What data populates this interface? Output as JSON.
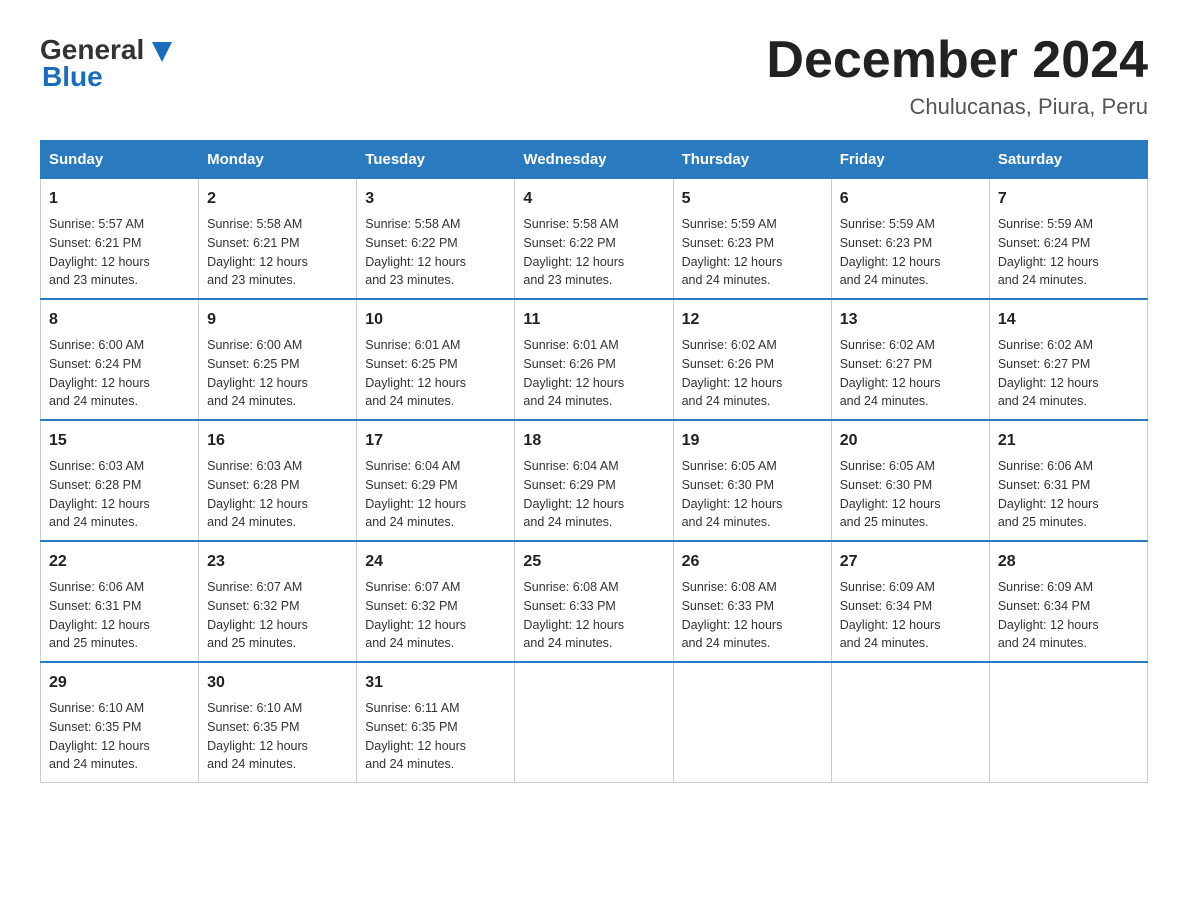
{
  "header": {
    "logo_general": "General",
    "logo_blue": "Blue",
    "month_title": "December 2024",
    "location": "Chulucanas, Piura, Peru"
  },
  "days_of_week": [
    "Sunday",
    "Monday",
    "Tuesday",
    "Wednesday",
    "Thursday",
    "Friday",
    "Saturday"
  ],
  "weeks": [
    [
      {
        "day": "1",
        "sunrise": "5:57 AM",
        "sunset": "6:21 PM",
        "daylight": "12 hours and 23 minutes."
      },
      {
        "day": "2",
        "sunrise": "5:58 AM",
        "sunset": "6:21 PM",
        "daylight": "12 hours and 23 minutes."
      },
      {
        "day": "3",
        "sunrise": "5:58 AM",
        "sunset": "6:22 PM",
        "daylight": "12 hours and 23 minutes."
      },
      {
        "day": "4",
        "sunrise": "5:58 AM",
        "sunset": "6:22 PM",
        "daylight": "12 hours and 23 minutes."
      },
      {
        "day": "5",
        "sunrise": "5:59 AM",
        "sunset": "6:23 PM",
        "daylight": "12 hours and 24 minutes."
      },
      {
        "day": "6",
        "sunrise": "5:59 AM",
        "sunset": "6:23 PM",
        "daylight": "12 hours and 24 minutes."
      },
      {
        "day": "7",
        "sunrise": "5:59 AM",
        "sunset": "6:24 PM",
        "daylight": "12 hours and 24 minutes."
      }
    ],
    [
      {
        "day": "8",
        "sunrise": "6:00 AM",
        "sunset": "6:24 PM",
        "daylight": "12 hours and 24 minutes."
      },
      {
        "day": "9",
        "sunrise": "6:00 AM",
        "sunset": "6:25 PM",
        "daylight": "12 hours and 24 minutes."
      },
      {
        "day": "10",
        "sunrise": "6:01 AM",
        "sunset": "6:25 PM",
        "daylight": "12 hours and 24 minutes."
      },
      {
        "day": "11",
        "sunrise": "6:01 AM",
        "sunset": "6:26 PM",
        "daylight": "12 hours and 24 minutes."
      },
      {
        "day": "12",
        "sunrise": "6:02 AM",
        "sunset": "6:26 PM",
        "daylight": "12 hours and 24 minutes."
      },
      {
        "day": "13",
        "sunrise": "6:02 AM",
        "sunset": "6:27 PM",
        "daylight": "12 hours and 24 minutes."
      },
      {
        "day": "14",
        "sunrise": "6:02 AM",
        "sunset": "6:27 PM",
        "daylight": "12 hours and 24 minutes."
      }
    ],
    [
      {
        "day": "15",
        "sunrise": "6:03 AM",
        "sunset": "6:28 PM",
        "daylight": "12 hours and 24 minutes."
      },
      {
        "day": "16",
        "sunrise": "6:03 AM",
        "sunset": "6:28 PM",
        "daylight": "12 hours and 24 minutes."
      },
      {
        "day": "17",
        "sunrise": "6:04 AM",
        "sunset": "6:29 PM",
        "daylight": "12 hours and 24 minutes."
      },
      {
        "day": "18",
        "sunrise": "6:04 AM",
        "sunset": "6:29 PM",
        "daylight": "12 hours and 24 minutes."
      },
      {
        "day": "19",
        "sunrise": "6:05 AM",
        "sunset": "6:30 PM",
        "daylight": "12 hours and 24 minutes."
      },
      {
        "day": "20",
        "sunrise": "6:05 AM",
        "sunset": "6:30 PM",
        "daylight": "12 hours and 25 minutes."
      },
      {
        "day": "21",
        "sunrise": "6:06 AM",
        "sunset": "6:31 PM",
        "daylight": "12 hours and 25 minutes."
      }
    ],
    [
      {
        "day": "22",
        "sunrise": "6:06 AM",
        "sunset": "6:31 PM",
        "daylight": "12 hours and 25 minutes."
      },
      {
        "day": "23",
        "sunrise": "6:07 AM",
        "sunset": "6:32 PM",
        "daylight": "12 hours and 25 minutes."
      },
      {
        "day": "24",
        "sunrise": "6:07 AM",
        "sunset": "6:32 PM",
        "daylight": "12 hours and 24 minutes."
      },
      {
        "day": "25",
        "sunrise": "6:08 AM",
        "sunset": "6:33 PM",
        "daylight": "12 hours and 24 minutes."
      },
      {
        "day": "26",
        "sunrise": "6:08 AM",
        "sunset": "6:33 PM",
        "daylight": "12 hours and 24 minutes."
      },
      {
        "day": "27",
        "sunrise": "6:09 AM",
        "sunset": "6:34 PM",
        "daylight": "12 hours and 24 minutes."
      },
      {
        "day": "28",
        "sunrise": "6:09 AM",
        "sunset": "6:34 PM",
        "daylight": "12 hours and 24 minutes."
      }
    ],
    [
      {
        "day": "29",
        "sunrise": "6:10 AM",
        "sunset": "6:35 PM",
        "daylight": "12 hours and 24 minutes."
      },
      {
        "day": "30",
        "sunrise": "6:10 AM",
        "sunset": "6:35 PM",
        "daylight": "12 hours and 24 minutes."
      },
      {
        "day": "31",
        "sunrise": "6:11 AM",
        "sunset": "6:35 PM",
        "daylight": "12 hours and 24 minutes."
      },
      null,
      null,
      null,
      null
    ]
  ],
  "labels": {
    "sunrise": "Sunrise:",
    "sunset": "Sunset:",
    "daylight": "Daylight: 12 hours"
  }
}
